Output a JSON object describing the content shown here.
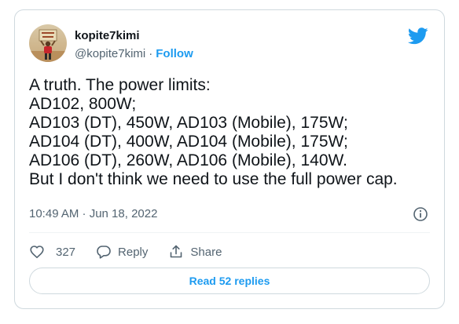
{
  "tweet": {
    "author": {
      "display_name": "kopite7kimi",
      "handle": "@kopite7kimi",
      "separator": "·",
      "follow_label": "Follow",
      "avatar_icon": "avatar-person-holding-sign"
    },
    "brand": {
      "icon": "twitter-bird-icon",
      "accent_color": "#1d9bf0"
    },
    "text_lines": [
      "A truth. The power limits:",
      "AD102, 800W;",
      "AD103 (DT), 450W, AD103 (Mobile), 175W;",
      "AD104 (DT), 400W, AD104 (Mobile), 175W;",
      "AD106 (DT), 260W, AD106 (Mobile), 140W.",
      "But I don't think we need to use the full power cap."
    ],
    "timestamp": "10:49 AM · Jun 18, 2022",
    "info_icon": "info-circle-icon",
    "actions": {
      "like_count": "327",
      "reply_label": "Reply",
      "share_label": "Share"
    },
    "read_replies_label": "Read 52 replies"
  }
}
